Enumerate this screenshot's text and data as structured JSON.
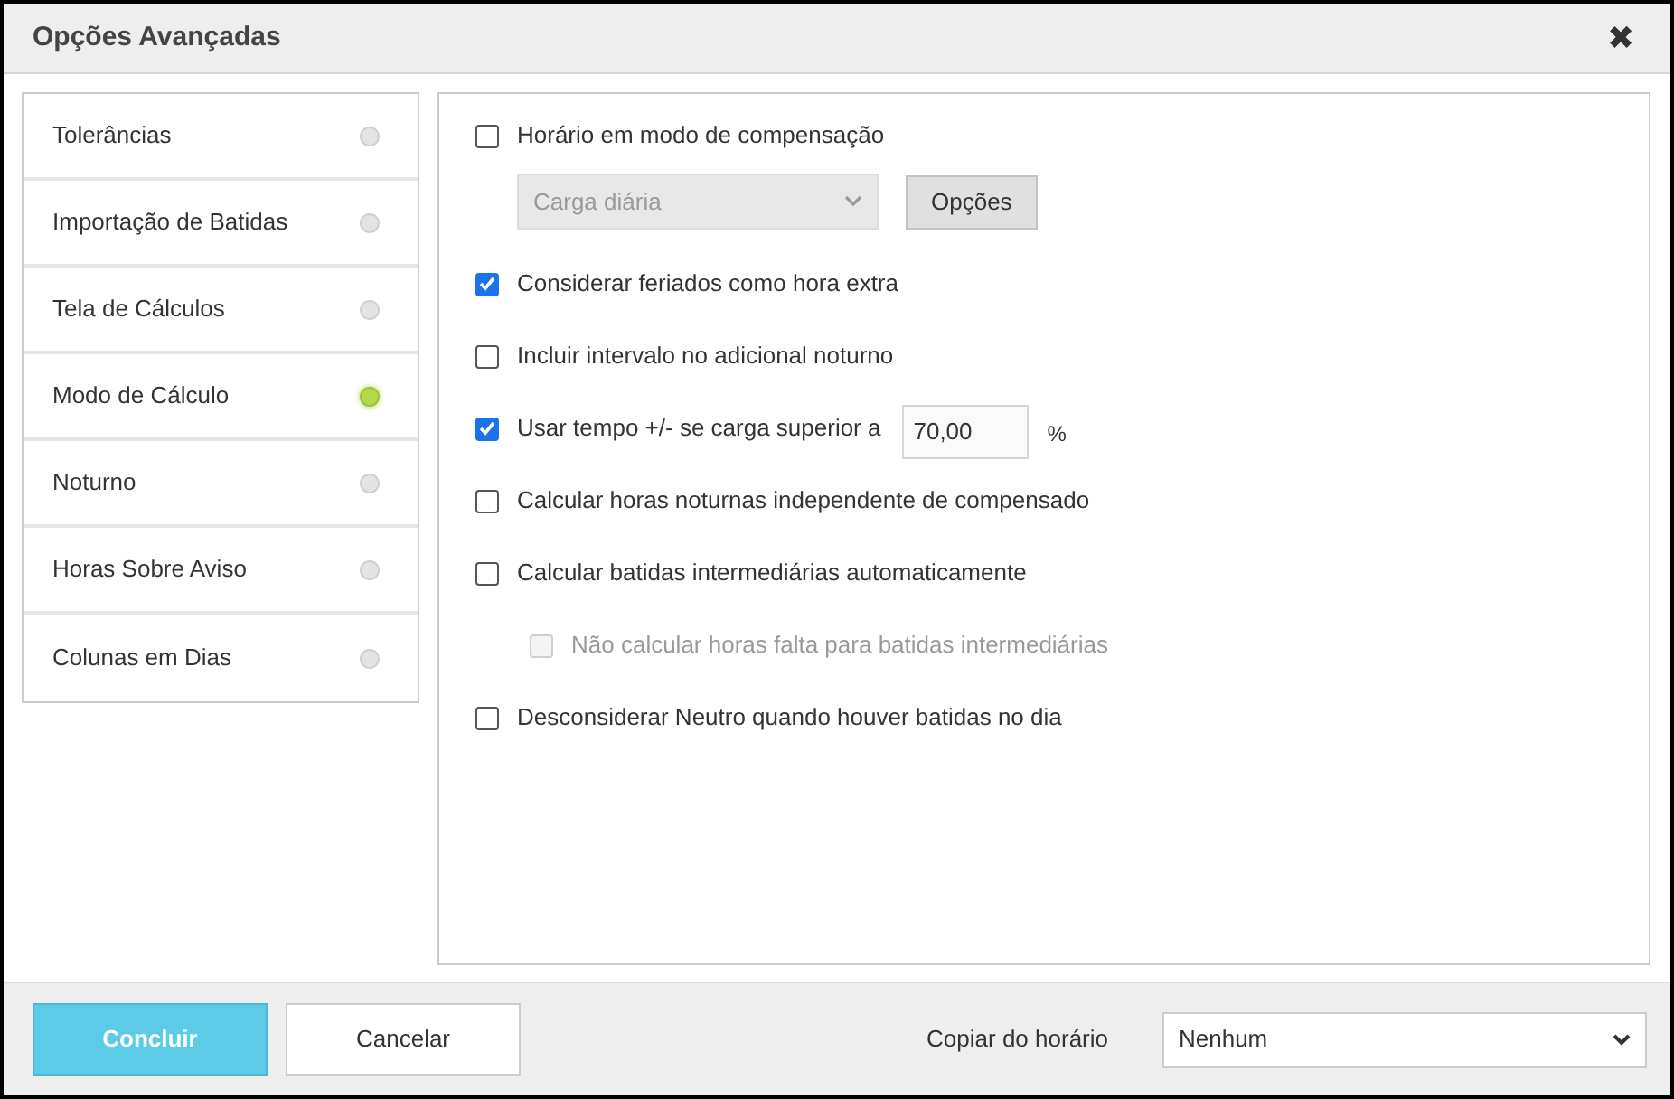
{
  "window": {
    "title": "Opções Avançadas",
    "close": "✖"
  },
  "sidebar": {
    "items": [
      {
        "label": "Tolerâncias",
        "selected": false
      },
      {
        "label": "Importação de Batidas",
        "selected": false
      },
      {
        "label": "Tela de Cálculos",
        "selected": false
      },
      {
        "label": "Modo de Cálculo",
        "selected": true
      },
      {
        "label": "Noturno",
        "selected": false
      },
      {
        "label": "Horas Sobre Aviso",
        "selected": false
      },
      {
        "label": "Colunas em Dias",
        "selected": false
      }
    ]
  },
  "options": [
    {
      "kind": "checkbox",
      "label": "Horário em modo de compensação",
      "checked": false,
      "disabled": false,
      "select": {
        "value": "Carga diária",
        "disabled": true
      },
      "button": "Opções"
    },
    {
      "kind": "checkbox",
      "label": "Considerar feriados como hora extra",
      "checked": true,
      "disabled": false
    },
    {
      "kind": "checkbox",
      "label": "Incluir intervalo no adicional noturno",
      "checked": false,
      "disabled": false
    },
    {
      "kind": "checkbox",
      "label": "Usar tempo +/- se carga superior a",
      "checked": true,
      "disabled": false,
      "input": {
        "value": "70,00",
        "unit": "%"
      }
    },
    {
      "kind": "checkbox",
      "label": "Calcular horas noturnas independente de compensado",
      "checked": false,
      "disabled": false
    },
    {
      "kind": "checkbox",
      "label": "Calcular batidas intermediárias automaticamente",
      "checked": false,
      "disabled": false,
      "children": [
        {
          "kind": "checkbox",
          "label": "Não calcular horas falta para batidas intermediárias",
          "checked": false,
          "disabled": true
        }
      ]
    },
    {
      "kind": "checkbox",
      "label": "Desconsiderar Neutro quando houver batidas no dia",
      "checked": false,
      "disabled": false
    }
  ],
  "footer": {
    "buttons": [
      {
        "label": "Concluir",
        "kind": "primary"
      },
      {
        "label": "Cancelar",
        "kind": "secondary"
      }
    ],
    "copy_label": "Copiar do horário",
    "copy_select": "Nenhum"
  }
}
